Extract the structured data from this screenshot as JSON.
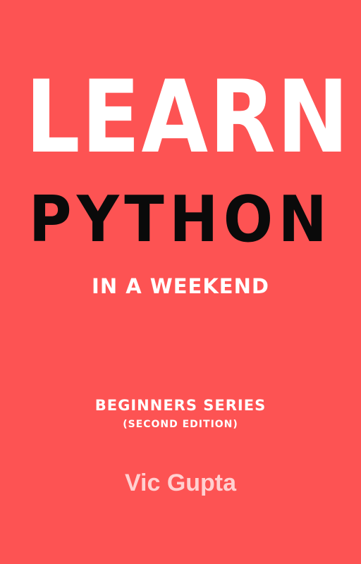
{
  "cover": {
    "background_color": "#fd5353",
    "title_line1": "LEARN",
    "title_line2": "PYTHON",
    "subtitle": "IN A WEEKEND",
    "series": "BEGINNERS SERIES",
    "edition": "(SECOND EDITION)",
    "author": "Vic Gupta"
  }
}
